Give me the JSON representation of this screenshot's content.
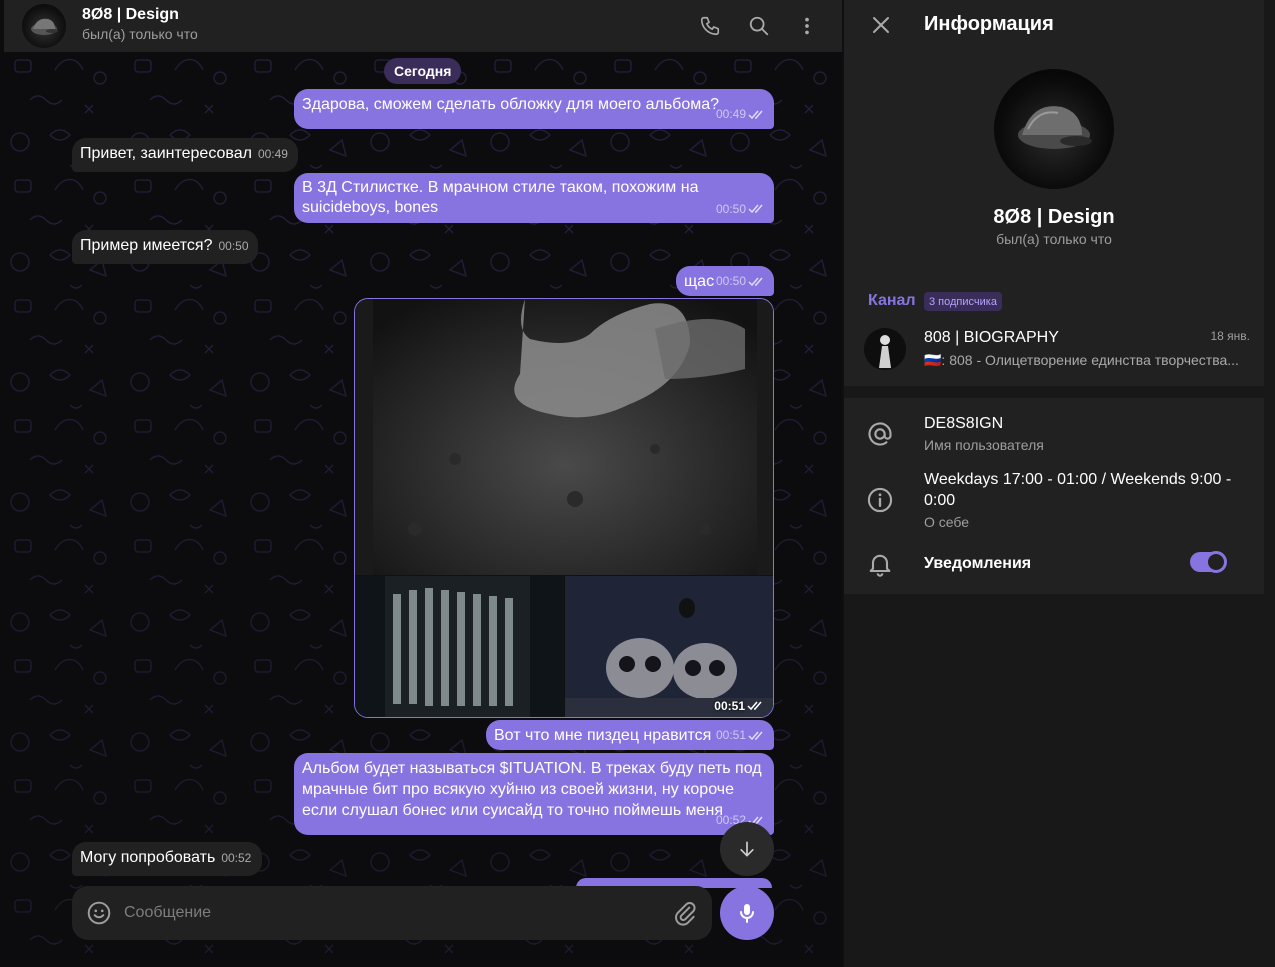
{
  "chat": {
    "header": {
      "title": "8Ø8 | Design",
      "status": "был(а) только что"
    },
    "date_label": "Сегодня",
    "messages": [
      {
        "dir": "out",
        "text": "Здарова, сможем сделать обложку для моего альбома?",
        "time": "00:49"
      },
      {
        "dir": "in",
        "text": "Привет, заинтересовал",
        "time": "00:49"
      },
      {
        "dir": "out",
        "line1": "В 3Д Стилистке. В мрачном стиле таком, похожим на",
        "line2": "suicideboys, bones",
        "time": "00:50"
      },
      {
        "dir": "in",
        "text": "Пример имеется?",
        "time": "00:50"
      },
      {
        "dir": "out",
        "text": "щас",
        "time": "00:50"
      },
      {
        "dir": "out",
        "type": "album",
        "time": "00:51"
      },
      {
        "dir": "out",
        "text": "Вот что мне пиздец нравится",
        "time": "00:51"
      },
      {
        "dir": "out",
        "line1": "Альбом будет называться $ITUATION. В треках буду петь под",
        "line2": "мрачные бит про всякую хуйню из своей жизни, ну короче",
        "line3": "если слушал бонес или суисайд то точно поймешь меня",
        "time": "00:52"
      },
      {
        "dir": "in",
        "text": "Могу попробовать",
        "time": "00:52"
      }
    ],
    "composer": {
      "placeholder": "Сообщение"
    }
  },
  "info": {
    "title": "Информация",
    "name": "8Ø8 | Design",
    "status": "был(а) только что",
    "channel": {
      "label": "Канал",
      "subscribers": "3 подписчика",
      "name": "808 | BIOGRAPHY",
      "date": "18 янв.",
      "description": "🇷🇺: 808 - Олицетворение единства творчества..."
    },
    "username": {
      "value": "DE8S8IGN",
      "label": "Имя пользователя"
    },
    "bio": {
      "value": "Weekdays 17:00 - 01:00 / Weekends 9:00 - 0:00",
      "label": "О себе"
    },
    "notifications": {
      "label": "Уведомления",
      "enabled": true
    }
  },
  "colors": {
    "accent": "#8774e1",
    "outgoing_bubble": "#8774e1",
    "incoming_bubble": "#212121",
    "panel": "#212121",
    "background": "#0c0c0e"
  },
  "icons": [
    "phone-icon",
    "search-icon",
    "more-vertical-icon",
    "close-icon",
    "at-icon",
    "info-icon",
    "bell-icon",
    "emoji-icon",
    "attach-icon",
    "mic-icon",
    "arrow-down-icon",
    "double-check-icon"
  ]
}
